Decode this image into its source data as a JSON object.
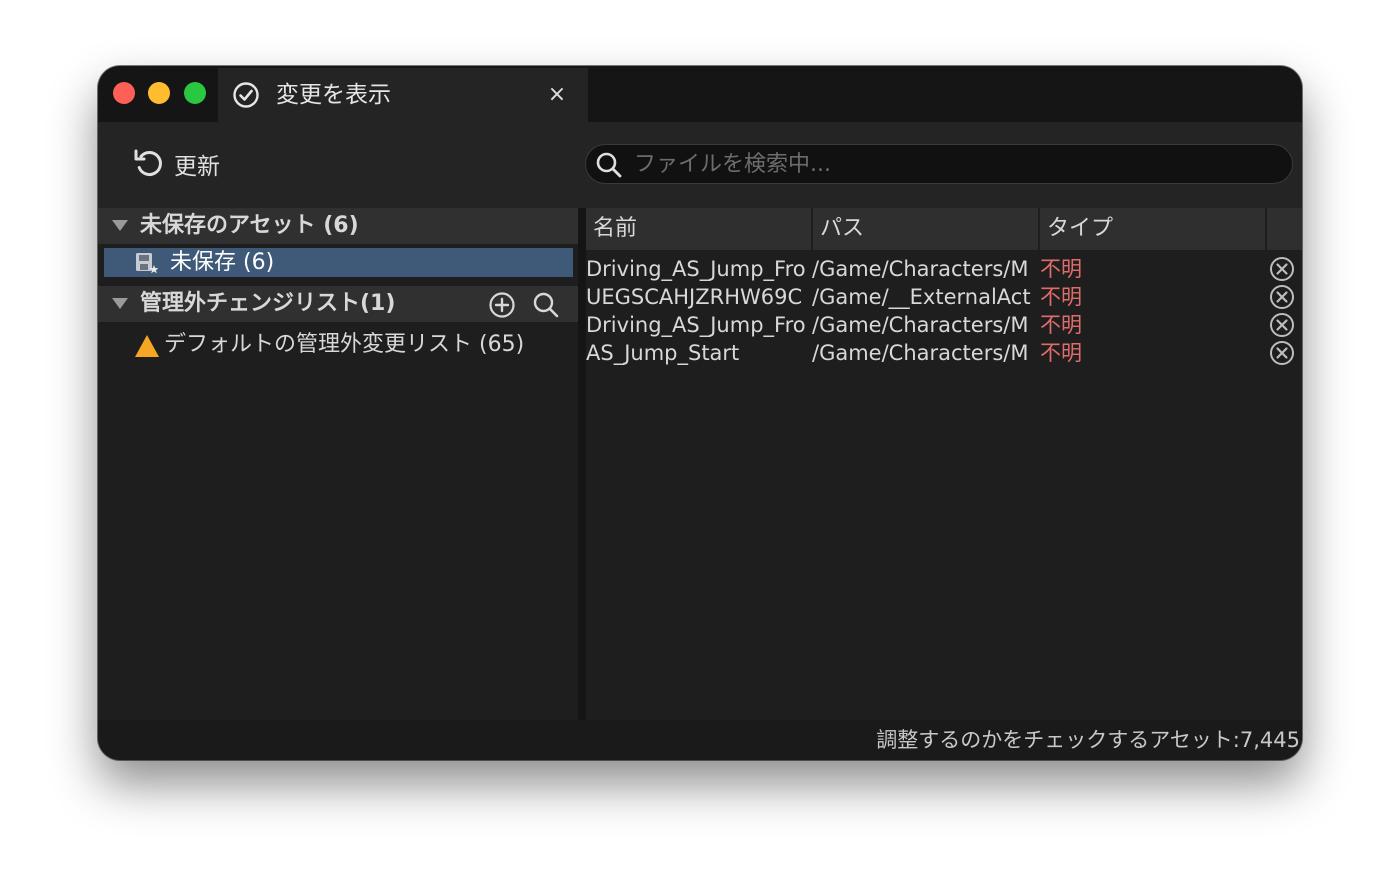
{
  "window": {
    "tab_title": "変更を表示",
    "tab_close": "×"
  },
  "toolbar": {
    "refresh_label": "更新"
  },
  "search": {
    "placeholder": "ファイルを検索中...",
    "value": ""
  },
  "left": {
    "unsaved_header": "未保存のアセット (6)",
    "unsaved_item": "未保存 (6)",
    "changelist_header": "管理外チェンジリスト(1)",
    "default_changelist": "デフォルトの管理外変更リスト (65)"
  },
  "table": {
    "columns": [
      "名前",
      "パス",
      "タイプ"
    ],
    "rows": [
      {
        "name": "Driving_AS_Jump_Fro",
        "path": "/Game/Characters/M",
        "type": "不明"
      },
      {
        "name": "UEGSCAHJZRHW69C",
        "path": "/Game/__ExternalAct",
        "type": "不明"
      },
      {
        "name": "Driving_AS_Jump_Fro",
        "path": "/Game/Characters/M",
        "type": "不明"
      },
      {
        "name": "AS_Jump_Start",
        "path": "/Game/Characters/M",
        "type": "不明"
      }
    ]
  },
  "status": {
    "text": "調整するのかをチェックするアセット:7,445"
  },
  "colors": {
    "accent_selection": "#3e5a78",
    "type_unknown": "#e06c6c",
    "warning": "#f5a623"
  }
}
